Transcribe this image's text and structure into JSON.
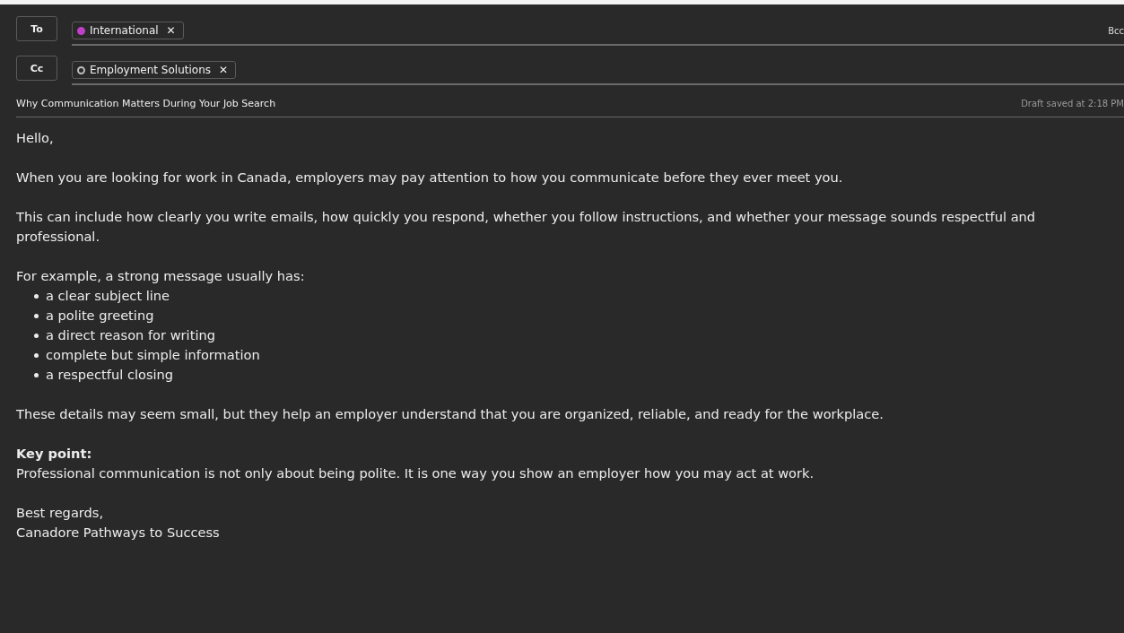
{
  "to": {
    "label": "To",
    "recipients": [
      {
        "name": "International",
        "kind": "filled",
        "color": "#c040c8",
        "remove": "✕"
      }
    ],
    "bcc": "Bcc"
  },
  "cc": {
    "label": "Cc",
    "recipients": [
      {
        "name": "Employment Solutions",
        "kind": "outline",
        "color": "#bdbdbd",
        "remove": "✕"
      }
    ]
  },
  "subject": "Why Communication Matters During Your Job Search",
  "draft_status": "Draft saved at 2:18 PM",
  "body": [
    {
      "kind": "paragraph",
      "text": "Hello,"
    },
    {
      "kind": "paragraph",
      "text": "When you are looking for work in Canada, employers may pay attention to how you communicate before they ever meet you."
    },
    {
      "kind": "paragraph",
      "text": "This can include how clearly you write emails, how quickly you respond, whether you follow instructions, and whether your message sounds respectful and professional."
    },
    {
      "kind": "list",
      "intro": "For example, a strong message usually has:",
      "items": [
        "a clear subject line",
        "a polite greeting",
        "a direct reason for writing",
        "complete but simple information",
        "a respectful closing"
      ]
    },
    {
      "kind": "paragraph",
      "text": "These details may seem small, but they help an employer understand that you are organized, reliable, and ready for the workplace."
    },
    {
      "kind": "callout",
      "heading": "Key point:",
      "text": "Professional communication is not only about being polite. It is one way you show an employer how you may act at work."
    },
    {
      "kind": "signature",
      "lines": [
        "Best regards,",
        "Canadore Pathways to Success"
      ]
    }
  ]
}
